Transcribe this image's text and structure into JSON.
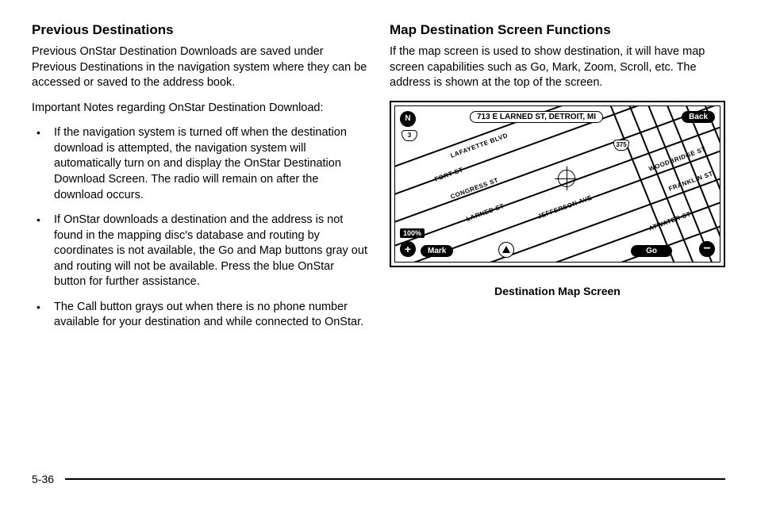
{
  "left": {
    "heading": "Previous Destinations",
    "p1": "Previous OnStar Destination Downloads are saved under Previous Destinations in the navigation system where they can be accessed or saved to the address book.",
    "p2": "Important Notes regarding OnStar Destination Download:",
    "bullets": [
      "If the navigation system is turned off when the destination download is attempted, the navigation system will automatically turn on and display the OnStar Destination Download Screen. The radio will remain on after the download occurs.",
      "If OnStar downloads a destination and the address is not found in the mapping disc's database and routing by coordinates is not available, the Go and Map buttons gray out and routing will not be available. Press the blue OnStar button for further assistance.",
      "The Call button grays out when there is no phone number available for your destination and while connected to OnStar."
    ]
  },
  "right": {
    "heading": "Map Destination Screen Functions",
    "p1": "If the map screen is used to show destination, it will have map screen capabilities such as Go, Mark, Zoom, Scroll, etc. The address is shown at the top of the screen.",
    "caption": "Destination Map Screen"
  },
  "map": {
    "north": "N",
    "address": "713 E LARNED ST, DETROIT, MI",
    "back": "Back",
    "route3": "3",
    "route375": "375",
    "scale": "100%",
    "mark": "Mark",
    "go": "Go",
    "plus": "+",
    "minus": "−",
    "streets": {
      "lafayette": "LAFAYETTE BLVD",
      "fort": "FORT ST",
      "congress": "CONGRESS ST",
      "larned": "LARNED ST",
      "jefferson": "JEFFERSON AVE",
      "woodbridge": "WOODBRIDGE ST",
      "franklin": "FRANKLIN ST",
      "atwater": "ATWATER ST"
    }
  },
  "page_number": "5-36"
}
